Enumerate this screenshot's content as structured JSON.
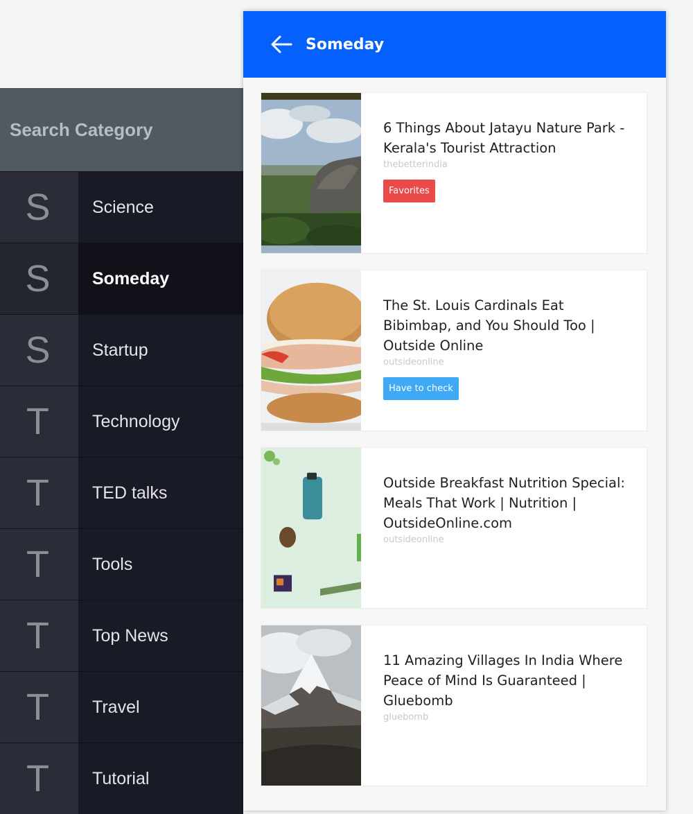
{
  "sidebar": {
    "search_placeholder": "Search Category",
    "categories": [
      {
        "letter": "S",
        "label": "Science"
      },
      {
        "letter": "S",
        "label": "Someday"
      },
      {
        "letter": "S",
        "label": "Startup"
      },
      {
        "letter": "T",
        "label": "Technology"
      },
      {
        "letter": "T",
        "label": "TED talks"
      },
      {
        "letter": "T",
        "label": "Tools"
      },
      {
        "letter": "T",
        "label": "Top News"
      },
      {
        "letter": "T",
        "label": "Travel"
      },
      {
        "letter": "T",
        "label": "Tutorial"
      }
    ],
    "active_category": "Someday"
  },
  "appbar": {
    "back_icon": "arrow-left-icon",
    "title": "Someday",
    "color": "#0561fe"
  },
  "feed": [
    {
      "title": "6 Things About Jatayu Nature Park - Kerala's Tourist Attraction",
      "source": "thebetterindia",
      "tag": "Favorites",
      "tag_color": "#ea4a4a",
      "image": "rocky-hill-landscape-photo"
    },
    {
      "title": "The St. Louis Cardinals Eat Bibimbap, and You Should Too | Outside Online",
      "source": "outsideonline",
      "tag": "Have to check",
      "tag_color": "#3fa9f5",
      "image": "sandwich-photo"
    },
    {
      "title": "Outside Breakfast Nutrition Special: Meals That Work | Nutrition | OutsideOnline.com",
      "source": "outsideonline",
      "image": "snacks-flatlay-photo"
    },
    {
      "title": "11 Amazing Villages In India Where Peace of Mind Is Guaranteed | Gluebomb",
      "source": "gluebomb",
      "image": "snowy-mountain-photo"
    }
  ]
}
